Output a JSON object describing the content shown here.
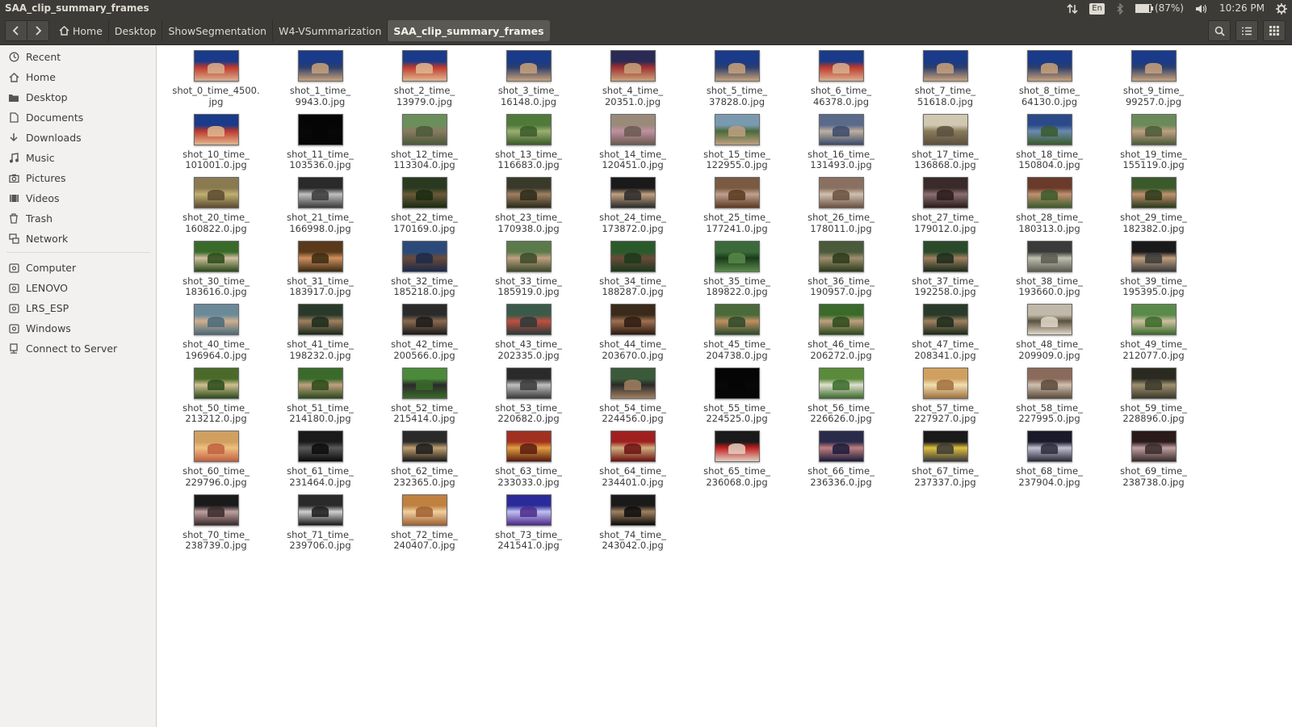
{
  "window_title": "SAA_clip_summary_frames",
  "indicators": {
    "keyboard": "En",
    "battery_text": "(87%)",
    "battery_level": 0.87,
    "time": "10:26 PM"
  },
  "icons": {
    "network": "transfer-arrows-icon",
    "bluetooth": "bluetooth-icon",
    "battery": "battery-icon",
    "volume": "volume-icon",
    "power": "gear-icon",
    "back": "chevron-left-icon",
    "forward": "chevron-right-icon",
    "home": "home-icon",
    "search": "search-icon",
    "list_view": "list-view-icon",
    "grid_view": "grid-view-icon"
  },
  "breadcrumb": [
    "Home",
    "Desktop",
    "ShowSegmentation",
    "W4-VSummarization",
    "SAA_clip_summary_frames"
  ],
  "sidebar": {
    "places": [
      {
        "label": "Recent",
        "icon": "clock-icon"
      },
      {
        "label": "Home",
        "icon": "home-icon"
      },
      {
        "label": "Desktop",
        "icon": "folder-icon"
      },
      {
        "label": "Documents",
        "icon": "document-icon"
      },
      {
        "label": "Downloads",
        "icon": "download-icon"
      },
      {
        "label": "Music",
        "icon": "music-icon"
      },
      {
        "label": "Pictures",
        "icon": "camera-icon"
      },
      {
        "label": "Videos",
        "icon": "film-icon"
      },
      {
        "label": "Trash",
        "icon": "trash-icon"
      },
      {
        "label": "Network",
        "icon": "network-icon"
      }
    ],
    "devices": [
      {
        "label": "Computer",
        "icon": "drive-icon"
      },
      {
        "label": "LENOVO",
        "icon": "drive-icon"
      },
      {
        "label": "LRS_ESP",
        "icon": "drive-icon"
      },
      {
        "label": "Windows",
        "icon": "drive-icon"
      },
      {
        "label": "Connect to Server",
        "icon": "server-icon"
      }
    ]
  },
  "files": [
    {
      "l1": "shot_0_time_4500.",
      "l2": "jpg",
      "colors": [
        "#1a3a8a",
        "#c0392b",
        "#d8b090"
      ]
    },
    {
      "l1": "shot_1_time_",
      "l2": "9943.0.jpg",
      "colors": [
        "#1a3a8a",
        "#2c3e6b",
        "#c9a27a"
      ]
    },
    {
      "l1": "shot_2_time_",
      "l2": "13979.0.jpg",
      "colors": [
        "#1a3a8a",
        "#c0392b",
        "#e0b890"
      ]
    },
    {
      "l1": "shot_3_time_",
      "l2": "16148.0.jpg",
      "colors": [
        "#1a3a8a",
        "#2c3e6b",
        "#c9a27a"
      ]
    },
    {
      "l1": "shot_4_time_",
      "l2": "20351.0.jpg",
      "colors": [
        "#2a2a55",
        "#a03030",
        "#c9a27a"
      ]
    },
    {
      "l1": "shot_5_time_",
      "l2": "37828.0.jpg",
      "colors": [
        "#1a3a8a",
        "#2c3e6b",
        "#c9a27a"
      ]
    },
    {
      "l1": "shot_6_time_",
      "l2": "46378.0.jpg",
      "colors": [
        "#1a3a8a",
        "#c0392b",
        "#d8b090"
      ]
    },
    {
      "l1": "shot_7_time_",
      "l2": "51618.0.jpg",
      "colors": [
        "#1a3a8a",
        "#2c3e6b",
        "#c9a27a"
      ]
    },
    {
      "l1": "shot_8_time_",
      "l2": "64130.0.jpg",
      "colors": [
        "#1a3a8a",
        "#2c3e6b",
        "#c9a27a"
      ]
    },
    {
      "l1": "shot_9_time_",
      "l2": "99257.0.jpg",
      "colors": [
        "#1a3a8a",
        "#2c3e6b",
        "#c9a27a"
      ]
    },
    {
      "l1": "shot_10_time_",
      "l2": "101001.0.jpg",
      "colors": [
        "#1a3a8a",
        "#c0392b",
        "#e0b890"
      ]
    },
    {
      "l1": "shot_11_time_",
      "l2": "103536.0.jpg",
      "colors": [
        "#050505",
        "#080808",
        "#050505"
      ]
    },
    {
      "l1": "shot_12_time_",
      "l2": "113304.0.jpg",
      "colors": [
        "#6b8f5a",
        "#8a7a60",
        "#4a5a3a"
      ]
    },
    {
      "l1": "shot_13_time_",
      "l2": "116683.0.jpg",
      "colors": [
        "#4f7a3a",
        "#9ab070",
        "#3a5a2a"
      ]
    },
    {
      "l1": "shot_14_time_",
      "l2": "120451.0.jpg",
      "colors": [
        "#9a8a7a",
        "#c090a0",
        "#6a5a50"
      ]
    },
    {
      "l1": "shot_15_time_",
      "l2": "122955.0.jpg",
      "colors": [
        "#7a9ab0",
        "#4a6a3a",
        "#c0a080"
      ]
    },
    {
      "l1": "shot_16_time_",
      "l2": "131493.0.jpg",
      "colors": [
        "#5a6a8a",
        "#c0b0a0",
        "#3a4a6a"
      ]
    },
    {
      "l1": "shot_17_time_",
      "l2": "136868.0.jpg",
      "colors": [
        "#d0c8b0",
        "#8a7a5a",
        "#5a5040"
      ]
    },
    {
      "l1": "shot_18_time_",
      "l2": "150804.0.jpg",
      "colors": [
        "#2a4a8a",
        "#6a8ab0",
        "#3a5a2a"
      ]
    },
    {
      "l1": "shot_19_time_",
      "l2": "155119.0.jpg",
      "colors": [
        "#6a8a5a",
        "#c0a080",
        "#4a5a3a"
      ]
    },
    {
      "l1": "shot_20_time_",
      "l2": "160822.0.jpg",
      "colors": [
        "#8a7a50",
        "#c0b070",
        "#5a4a30"
      ]
    },
    {
      "l1": "shot_21_time_",
      "l2": "166998.0.jpg",
      "colors": [
        "#2a2a2a",
        "#c0c0c0",
        "#3a3a3a"
      ]
    },
    {
      "l1": "shot_22_time_",
      "l2": "170169.0.jpg",
      "colors": [
        "#2a3a20",
        "#6a5a3a",
        "#1a2a10"
      ]
    },
    {
      "l1": "shot_23_time_",
      "l2": "170938.0.jpg",
      "colors": [
        "#3a3a2a",
        "#a08060",
        "#2a2a1a"
      ]
    },
    {
      "l1": "shot_24_time_",
      "l2": "173872.0.jpg",
      "colors": [
        "#1a1a1a",
        "#c0a080",
        "#2a2a2a"
      ]
    },
    {
      "l1": "shot_25_time_",
      "l2": "177241.0.jpg",
      "colors": [
        "#7a5a40",
        "#c0a090",
        "#5a3a20"
      ]
    },
    {
      "l1": "shot_26_time_",
      "l2": "178011.0.jpg",
      "colors": [
        "#8a7060",
        "#d0c0b0",
        "#6a5040"
      ]
    },
    {
      "l1": "shot_27_time_",
      "l2": "179012.0.jpg",
      "colors": [
        "#3a2a2a",
        "#8a7070",
        "#2a1a1a"
      ]
    },
    {
      "l1": "shot_28_time_",
      "l2": "180313.0.jpg",
      "colors": [
        "#6a3a2a",
        "#c09070",
        "#3a5a2a"
      ]
    },
    {
      "l1": "shot_29_time_",
      "l2": "182382.0.jpg",
      "colors": [
        "#3a5a2a",
        "#c09070",
        "#2a3a1a"
      ]
    },
    {
      "l1": "shot_30_time_",
      "l2": "183616.0.jpg",
      "colors": [
        "#3a6a2a",
        "#d0c0a0",
        "#2a4a1a"
      ]
    },
    {
      "l1": "shot_31_time_",
      "l2": "183917.0.jpg",
      "colors": [
        "#5a3a1a",
        "#d09060",
        "#3a2a10"
      ]
    },
    {
      "l1": "shot_32_time_",
      "l2": "185218.0.jpg",
      "colors": [
        "#2a4a7a",
        "#6a4a3a",
        "#1a2a4a"
      ]
    },
    {
      "l1": "shot_33_time_",
      "l2": "185919.0.jpg",
      "colors": [
        "#5a7a4a",
        "#c0a080",
        "#3a4a2a"
      ]
    },
    {
      "l1": "shot_34_time_",
      "l2": "188287.0.jpg",
      "colors": [
        "#2a5a2a",
        "#6a4a3a",
        "#1a3a1a"
      ]
    },
    {
      "l1": "shot_35_time_",
      "l2": "189822.0.jpg",
      "colors": [
        "#3a6a3a",
        "#1a3a1a",
        "#5a8a4a"
      ]
    },
    {
      "l1": "shot_36_time_",
      "l2": "190957.0.jpg",
      "colors": [
        "#4a5a3a",
        "#a09070",
        "#2a3a1a"
      ]
    },
    {
      "l1": "shot_37_time_",
      "l2": "192258.0.jpg",
      "colors": [
        "#2a4a2a",
        "#a08060",
        "#1a2a1a"
      ]
    },
    {
      "l1": "shot_38_time_",
      "l2": "193660.0.jpg",
      "colors": [
        "#3a3a3a",
        "#c0c0b0",
        "#5a5a50"
      ]
    },
    {
      "l1": "shot_39_time_",
      "l2": "195395.0.jpg",
      "colors": [
        "#1a1a1a",
        "#c0a080",
        "#3a3a3a"
      ]
    },
    {
      "l1": "shot_40_time_",
      "l2": "196964.0.jpg",
      "colors": [
        "#6a8a9a",
        "#d0b090",
        "#4a6a7a"
      ]
    },
    {
      "l1": "shot_41_time_",
      "l2": "198232.0.jpg",
      "colors": [
        "#2a3a2a",
        "#a08060",
        "#1a2a1a"
      ]
    },
    {
      "l1": "shot_42_time_",
      "l2": "200566.0.jpg",
      "colors": [
        "#2a2a2a",
        "#8a6a50",
        "#1a1a1a"
      ]
    },
    {
      "l1": "shot_43_time_",
      "l2": "202335.0.jpg",
      "colors": [
        "#3a5a4a",
        "#c05040",
        "#2a3a3a"
      ]
    },
    {
      "l1": "shot_44_time_",
      "l2": "203670.0.jpg",
      "colors": [
        "#3a2a1a",
        "#a07050",
        "#2a1a10"
      ]
    },
    {
      "l1": "shot_45_time_",
      "l2": "204738.0.jpg",
      "colors": [
        "#4a6a3a",
        "#c09060",
        "#2a4a2a"
      ]
    },
    {
      "l1": "shot_46_time_",
      "l2": "206272.0.jpg",
      "colors": [
        "#3a6a2a",
        "#c0a080",
        "#2a4a1a"
      ]
    },
    {
      "l1": "shot_47_time_",
      "l2": "208341.0.jpg",
      "colors": [
        "#2a3a2a",
        "#a08060",
        "#1a2a1a"
      ]
    },
    {
      "l1": "shot_48_time_",
      "l2": "209909.0.jpg",
      "colors": [
        "#c0b8a8",
        "#5a5040",
        "#e0d8c8"
      ]
    },
    {
      "l1": "shot_49_time_",
      "l2": "212077.0.jpg",
      "colors": [
        "#5a8a4a",
        "#d0c0a0",
        "#3a6a2a"
      ]
    },
    {
      "l1": "shot_50_time_",
      "l2": "213212.0.jpg",
      "colors": [
        "#4a6a2a",
        "#d0c090",
        "#2a4a1a"
      ]
    },
    {
      "l1": "shot_51_time_",
      "l2": "214180.0.jpg",
      "colors": [
        "#3a6a2a",
        "#c0a080",
        "#2a4a1a"
      ]
    },
    {
      "l1": "shot_52_time_",
      "l2": "215414.0.jpg",
      "colors": [
        "#4a8a3a",
        "#2a2a2a",
        "#3a6a2a"
      ]
    },
    {
      "l1": "shot_53_time_",
      "l2": "220682.0.jpg",
      "colors": [
        "#2a2a2a",
        "#c0c0c0",
        "#3a3a3a"
      ]
    },
    {
      "l1": "shot_54_time_",
      "l2": "224456.0.jpg",
      "colors": [
        "#3a5a3a",
        "#2a2a2a",
        "#a08060"
      ]
    },
    {
      "l1": "shot_55_time_",
      "l2": "224525.0.jpg",
      "colors": [
        "#050505",
        "#080808",
        "#050505"
      ]
    },
    {
      "l1": "shot_56_time_",
      "l2": "226626.0.jpg",
      "colors": [
        "#5a8a3a",
        "#e0e0d0",
        "#3a6a2a"
      ]
    },
    {
      "l1": "shot_57_time_",
      "l2": "227927.0.jpg",
      "colors": [
        "#d0a060",
        "#f0e0b0",
        "#a07040"
      ]
    },
    {
      "l1": "shot_58_time_",
      "l2": "227995.0.jpg",
      "colors": [
        "#8a6a5a",
        "#d0c0b0",
        "#5a4a3a"
      ]
    },
    {
      "l1": "shot_59_time_",
      "l2": "228896.0.jpg",
      "colors": [
        "#2a2a20",
        "#a09070",
        "#3a3a2a"
      ]
    },
    {
      "l1": "shot_60_time_",
      "l2": "229796.0.jpg",
      "colors": [
        "#d0a060",
        "#f0c080",
        "#c06040"
      ]
    },
    {
      "l1": "shot_61_time_",
      "l2": "231464.0.jpg",
      "colors": [
        "#1a1a1a",
        "#5a5a5a",
        "#0a0a0a"
      ]
    },
    {
      "l1": "shot_62_time_",
      "l2": "232365.0.jpg",
      "colors": [
        "#2a2a2a",
        "#c0a070",
        "#1a1a1a"
      ]
    },
    {
      "l1": "shot_63_time_",
      "l2": "233033.0.jpg",
      "colors": [
        "#a03020",
        "#e0a040",
        "#5a1a10"
      ]
    },
    {
      "l1": "shot_64_time_",
      "l2": "234401.0.jpg",
      "colors": [
        "#a02020",
        "#d0b080",
        "#6a1010"
      ]
    },
    {
      "l1": "shot_65_time_",
      "l2": "236068.0.jpg",
      "colors": [
        "#1a1a1a",
        "#c02020",
        "#e0d0c0"
      ]
    },
    {
      "l1": "shot_66_time_",
      "l2": "236336.0.jpg",
      "colors": [
        "#2a2a4a",
        "#c08080",
        "#1a1a3a"
      ]
    },
    {
      "l1": "shot_67_time_",
      "l2": "237337.0.jpg",
      "colors": [
        "#1a1a1a",
        "#e0c040",
        "#3a3a3a"
      ]
    },
    {
      "l1": "shot_68_time_",
      "l2": "237904.0.jpg",
      "colors": [
        "#1a1a2a",
        "#c0c0d0",
        "#2a2a3a"
      ]
    },
    {
      "l1": "shot_69_time_",
      "l2": "238738.0.jpg",
      "colors": [
        "#2a1a1a",
        "#c0a0a0",
        "#3a2a2a"
      ]
    },
    {
      "l1": "shot_70_time_",
      "l2": "238739.0.jpg",
      "colors": [
        "#1a1a1a",
        "#c0a0a0",
        "#3a2a2a"
      ]
    },
    {
      "l1": "shot_71_time_",
      "l2": "239706.0.jpg",
      "colors": [
        "#2a2a2a",
        "#d0d0d0",
        "#1a1a1a"
      ]
    },
    {
      "l1": "shot_72_time_",
      "l2": "240407.0.jpg",
      "colors": [
        "#c08040",
        "#f0d0a0",
        "#a06030"
      ]
    },
    {
      "l1": "shot_73_time_",
      "l2": "241541.0.jpg",
      "colors": [
        "#2a2a9a",
        "#c0c0f0",
        "#4a2a8a"
      ]
    },
    {
      "l1": "shot_74_time_",
      "l2": "243042.0.jpg",
      "colors": [
        "#1a1a1a",
        "#a08060",
        "#0a0a0a"
      ]
    }
  ]
}
